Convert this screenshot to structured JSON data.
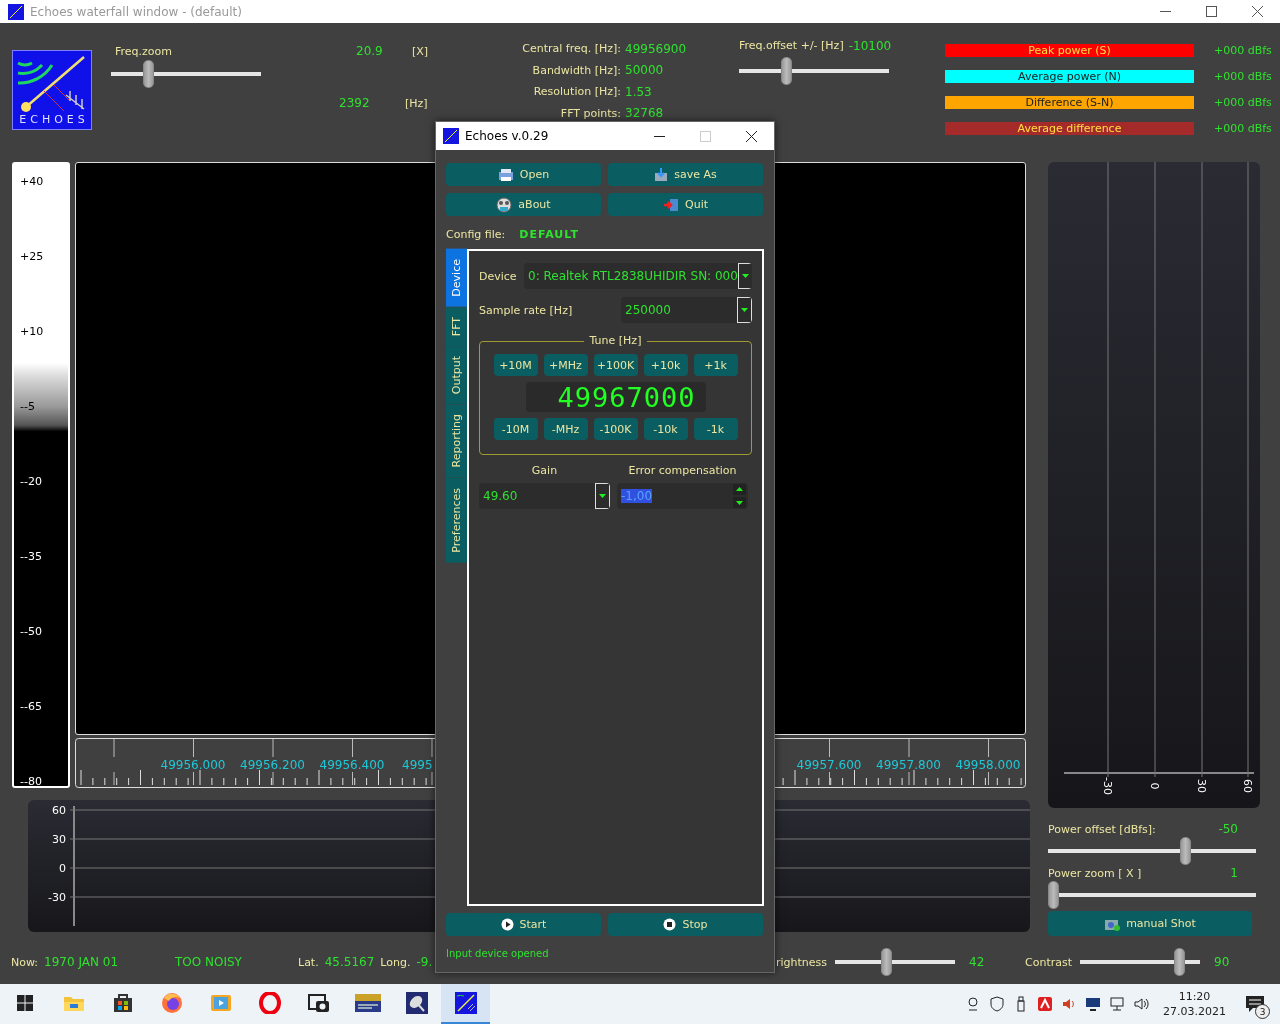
{
  "window": {
    "title": "Echoes waterfall window - (default)"
  },
  "logo": {
    "text": "ECHOES"
  },
  "freq_zoom": {
    "label": "Freq.zoom",
    "value": "20.9",
    "unit": "[X]",
    "level": 0.23,
    "hz_value": "2392",
    "hz_unit": "[Hz]"
  },
  "info": [
    {
      "label": "Central freq. [Hz]:",
      "value": "49956900"
    },
    {
      "label": "Bandwidth  [Hz]:",
      "value": "50000"
    },
    {
      "label": "Resolution [Hz]:",
      "value": "1.53"
    },
    {
      "label": "FFT points:",
      "value": "32768"
    }
  ],
  "freq_offset": {
    "label": "Freq.offset +/- [Hz]",
    "value": "-10100",
    "level": 0.3
  },
  "power_legend": [
    {
      "label": "Peak power (S)",
      "color": "#ff0000",
      "value": "+000 dBfs"
    },
    {
      "label": "Average power (N)",
      "color": "#00ffff",
      "value": "+000 dBfs"
    },
    {
      "label": "Difference (S-N)",
      "color": "#ffa500",
      "value": "+000 dBfs"
    },
    {
      "label": "Average difference",
      "color": "#a52a2a",
      "value": "+000 dBfs"
    }
  ],
  "scale": {
    "labels": [
      "+40",
      "+25",
      "+10",
      "--5",
      "--20",
      "--35",
      "--50",
      "--65",
      "--80"
    ]
  },
  "freq_axis": {
    "left_labels": [
      "49956.000",
      "49956.200",
      "49956.400"
    ],
    "cut_label": "4995",
    "right_labels": [
      "49957.600",
      "49957.800",
      "49958.000"
    ]
  },
  "power_panel": {
    "labels": [
      "-30",
      "0",
      "30",
      "60"
    ]
  },
  "bottom_chart": {
    "y_labels": [
      "60",
      "30",
      "0",
      "-30"
    ]
  },
  "power_offset": {
    "label": "Power offset [dBfs]:",
    "value": "-50",
    "level": 0.67
  },
  "power_zoom": {
    "label": "Power zoom  [ X ]",
    "value": "1",
    "level": 0
  },
  "manual_shot": {
    "label": "manual Shot"
  },
  "status": {
    "now_label": "Now:",
    "now_value": "1970 JAN 01",
    "noise": "TOO NOISY",
    "lat_label": "Lat.",
    "lat_value": "45.5167",
    "long_label": "Long.",
    "long_value": "-9.",
    "brightness": {
      "label": "rightness",
      "value": "42",
      "level": 0.42
    },
    "contrast": {
      "label": "Contrast",
      "value": "90",
      "level": 0.86
    }
  },
  "dialog": {
    "title": "Echoes v.0.29",
    "buttons": [
      {
        "kind": "open",
        "label": "Open"
      },
      {
        "kind": "save",
        "label": "save As"
      },
      {
        "kind": "about",
        "label": "aBout"
      },
      {
        "kind": "quit",
        "label": "Quit"
      }
    ],
    "config_label": "Config file:",
    "config_value": "DEFAULT",
    "tabs": [
      {
        "label": "Device",
        "selected": true
      },
      {
        "label": "FFT",
        "selected": false
      },
      {
        "label": "Output",
        "selected": false
      },
      {
        "label": "Reporting",
        "selected": false
      },
      {
        "label": "Preferences",
        "selected": false
      }
    ],
    "device": {
      "label": "Device",
      "value": "0: Realtek RTL2838UHIDIR  SN: 000"
    },
    "sample_rate": {
      "label": "Sample rate [Hz]",
      "value": "250000"
    },
    "tune": {
      "legend": "Tune [Hz]",
      "plus": [
        "+10M",
        "+MHz",
        "+100K",
        "+10k",
        "+1k"
      ],
      "display": "49967000",
      "minus": [
        "-10M",
        "-MHz",
        "-100K",
        "-10k",
        "-1k"
      ]
    },
    "gain": {
      "label": "Gain",
      "value": "49.60"
    },
    "error_compensation": {
      "label": "Error compensation",
      "value": "-1,00",
      "highlighted": true
    },
    "run_buttons": [
      {
        "kind": "start",
        "label": "Start"
      },
      {
        "kind": "stop",
        "label": "Stop"
      }
    ],
    "status": "Input device opened"
  },
  "taskbar": {
    "apps": [
      {
        "kind": "start",
        "selected": false
      },
      {
        "kind": "folder",
        "selected": false
      },
      {
        "kind": "store",
        "selected": false
      },
      {
        "kind": "firefox",
        "selected": false
      },
      {
        "kind": "media",
        "selected": false
      },
      {
        "kind": "opera",
        "selected": false
      },
      {
        "kind": "camera",
        "selected": false
      },
      {
        "kind": "wr",
        "selected": false
      },
      {
        "kind": "satellite",
        "selected": false
      },
      {
        "kind": "echoes",
        "selected": true
      }
    ],
    "time": "11:20",
    "date": "27.03.2021",
    "notifications": "3"
  }
}
